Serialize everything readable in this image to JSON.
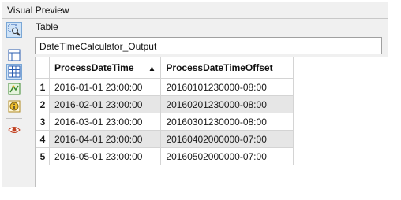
{
  "window": {
    "title": "Visual Preview"
  },
  "toolbar": {
    "tools": [
      {
        "icon": "zoom-select-icon",
        "active": true
      },
      {
        "icon": "single-panel-icon",
        "active": false
      },
      {
        "icon": "table-view-icon",
        "active": true
      },
      {
        "icon": "graphics-view-icon",
        "active": false
      },
      {
        "icon": "feature-info-icon",
        "active": false
      },
      {
        "icon": "inspector-eye-icon",
        "active": false
      }
    ]
  },
  "table": {
    "section_label": "Table",
    "name": "DateTimeCalculator_Output",
    "columns": [
      "ProcessDateTime",
      "ProcessDateTimeOffset"
    ],
    "sort_column": "ProcessDateTime",
    "sort_indicator": "▲",
    "rows": [
      {
        "num": "1",
        "cells": [
          "2016-01-01 23:00:00",
          "20160101230000-08:00"
        ]
      },
      {
        "num": "2",
        "cells": [
          "2016-02-01 23:00:00",
          "20160201230000-08:00"
        ]
      },
      {
        "num": "3",
        "cells": [
          "2016-03-01 23:00:00",
          "20160301230000-08:00"
        ]
      },
      {
        "num": "4",
        "cells": [
          "2016-04-01 23:00:00",
          "20160402000000-07:00"
        ]
      },
      {
        "num": "5",
        "cells": [
          "2016-05-01 23:00:00",
          "20160502000000-07:00"
        ]
      }
    ]
  }
}
